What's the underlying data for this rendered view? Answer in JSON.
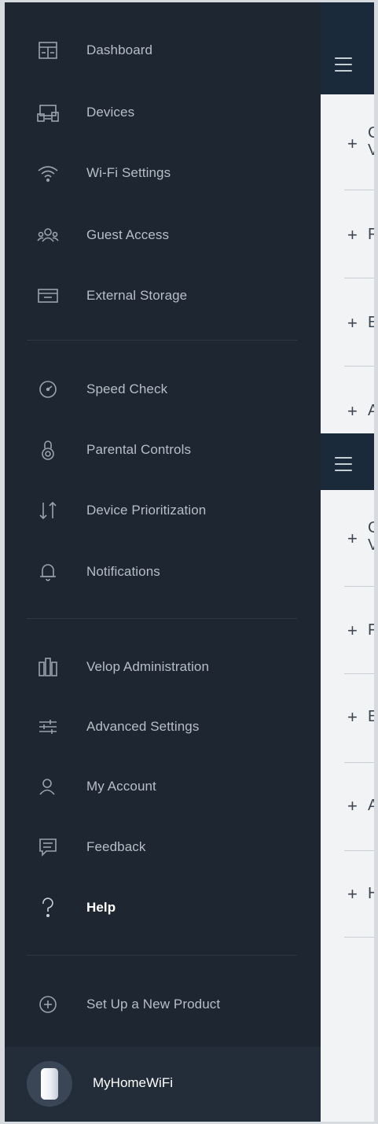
{
  "drawer": {
    "items": [
      {
        "label": "Dashboard",
        "icon": "dashboard-icon"
      },
      {
        "label": "Devices",
        "icon": "devices-icon"
      },
      {
        "label": "Wi-Fi Settings",
        "icon": "wifi-icon"
      },
      {
        "label": "Guest Access",
        "icon": "guest-access-icon"
      },
      {
        "label": "External Storage",
        "icon": "external-storage-icon"
      },
      {
        "label": "Speed Check",
        "icon": "speed-check-icon"
      },
      {
        "label": "Parental Controls",
        "icon": "parental-controls-icon"
      },
      {
        "label": "Device Prioritization",
        "icon": "device-prioritization-icon"
      },
      {
        "label": "Notifications",
        "icon": "bell-icon"
      },
      {
        "label": "Velop Administration",
        "icon": "velop-admin-icon"
      },
      {
        "label": "Advanced Settings",
        "icon": "sliders-icon"
      },
      {
        "label": "My Account",
        "icon": "user-icon"
      },
      {
        "label": "Feedback",
        "icon": "feedback-icon"
      },
      {
        "label": "Help",
        "icon": "help-icon",
        "active": true
      },
      {
        "label": "Set Up a New Product",
        "icon": "add-circle-icon"
      }
    ],
    "footer": {
      "network_name": "MyHomeWiFi"
    }
  },
  "background_panel": {
    "rows_visible_initials": [
      "C\nV",
      "F",
      "E",
      "A",
      "C\nV",
      "F",
      "E",
      "A",
      "H"
    ]
  },
  "colors": {
    "drawer_bg": "#1d2631",
    "footer_bg": "#232d39",
    "header_bg": "#1a2a3a",
    "content_bg": "#f2f3f4",
    "label": "#b7bec7",
    "active_label": "#ffffff"
  }
}
